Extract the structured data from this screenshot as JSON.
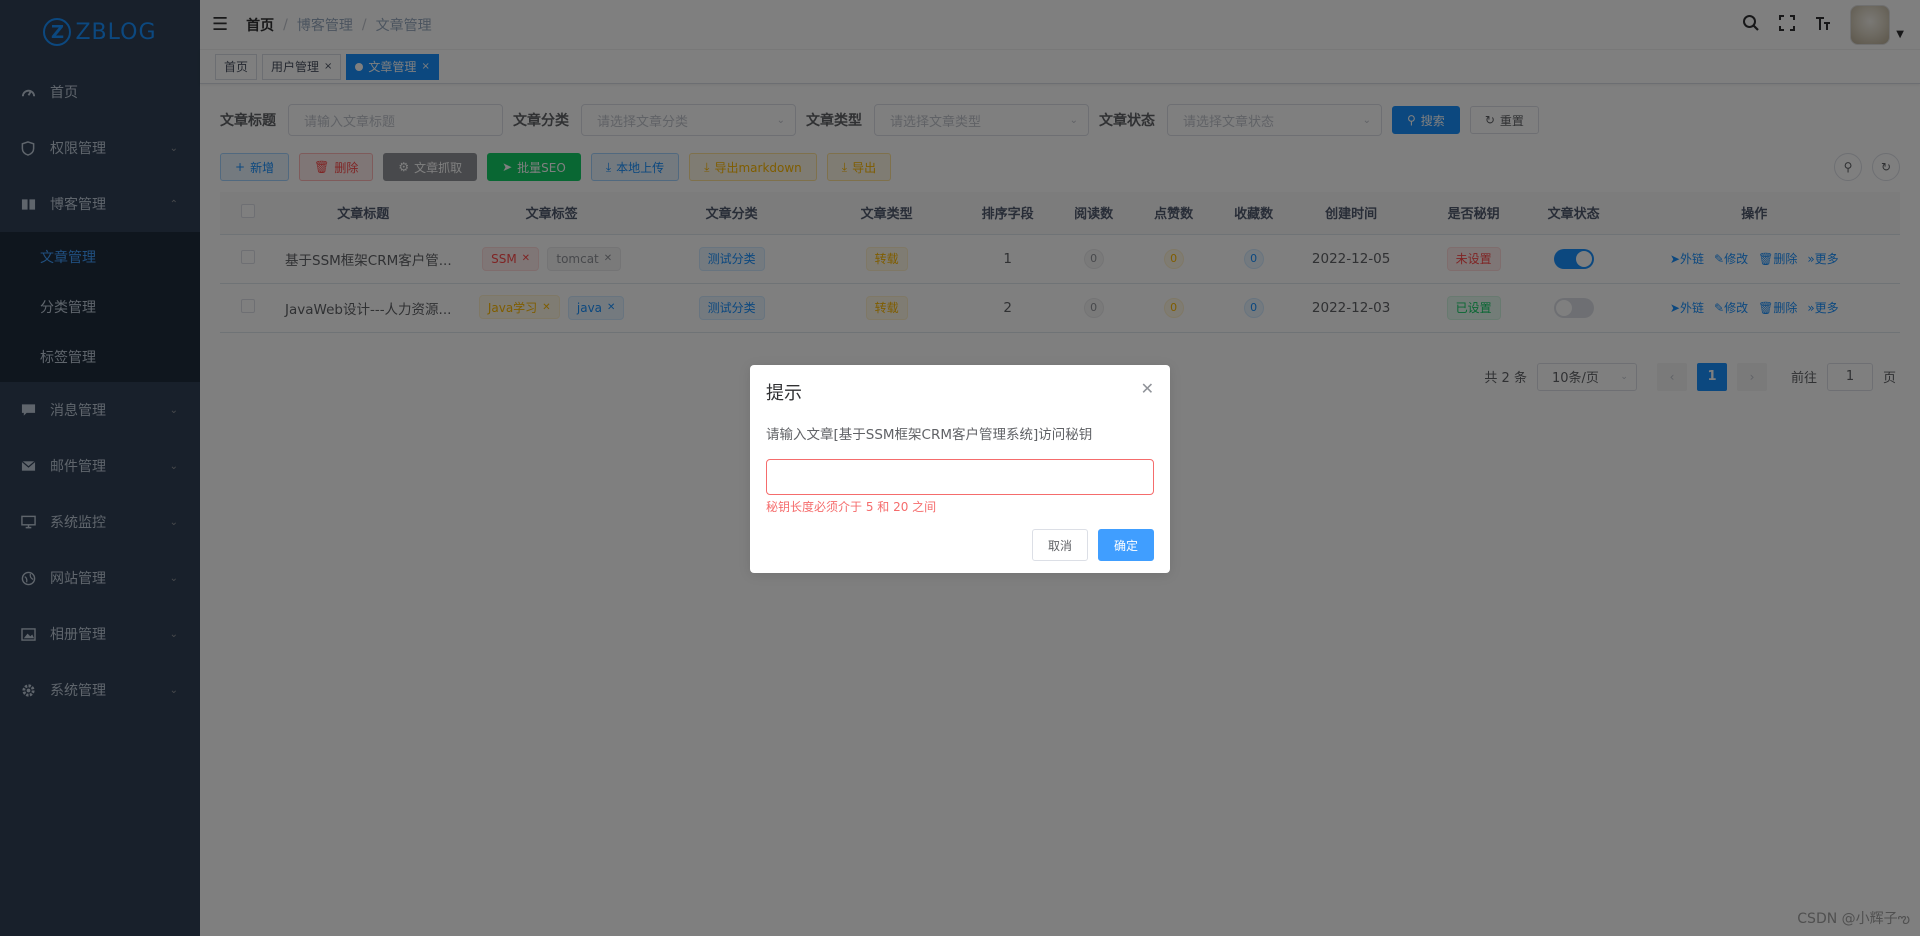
{
  "app": {
    "logo_letter": "Z",
    "logo_text": "ZBLOG"
  },
  "sidebar": {
    "items": [
      {
        "label": "首页",
        "icon": "dashboard-icon"
      },
      {
        "label": "权限管理",
        "icon": "shield-icon"
      },
      {
        "label": "博客管理",
        "icon": "book-icon"
      },
      {
        "label": "消息管理",
        "icon": "message-icon"
      },
      {
        "label": "邮件管理",
        "icon": "mail-icon"
      },
      {
        "label": "系统监控",
        "icon": "monitor-icon"
      },
      {
        "label": "网站管理",
        "icon": "globe-icon"
      },
      {
        "label": "相册管理",
        "icon": "image-icon"
      },
      {
        "label": "系统管理",
        "icon": "gear-icon"
      }
    ],
    "sub_items": [
      {
        "label": "文章管理"
      },
      {
        "label": "分类管理"
      },
      {
        "label": "标签管理"
      }
    ]
  },
  "breadcrumb": {
    "items": [
      "首页",
      "博客管理",
      "文章管理"
    ]
  },
  "tags_view": {
    "tabs": [
      "首页",
      "用户管理",
      "文章管理"
    ]
  },
  "search": {
    "title_label": "文章标题",
    "title_placeholder": "请输入文章标题",
    "category_label": "文章分类",
    "category_placeholder": "请选择文章分类",
    "type_label": "文章类型",
    "type_placeholder": "请选择文章类型",
    "status_label": "文章状态",
    "status_placeholder": "请选择文章状态",
    "search_btn": "搜索",
    "reset_btn": "重置"
  },
  "toolbar": {
    "add": "新增",
    "delete": "删除",
    "crawl": "文章抓取",
    "seo": "批量SEO",
    "upload": "本地上传",
    "export_md": "导出markdown",
    "export": "导出"
  },
  "table": {
    "headers": [
      "文章标题",
      "文章标签",
      "文章分类",
      "文章类型",
      "排序字段",
      "阅读数",
      "点赞数",
      "收藏数",
      "创建时间",
      "是否秘钥",
      "文章状态",
      "操作"
    ],
    "rows": [
      {
        "title": "基于SSM框架CRM客户管...",
        "tags": [
          "SSM",
          "tomcat"
        ],
        "category": "测试分类",
        "type": "转载",
        "sort": "1",
        "views": "0",
        "likes": "0",
        "favorites": "0",
        "created": "2022-12-05",
        "secret": "未设置",
        "status_on": true
      },
      {
        "title": "JavaWeb设计---人力资源...",
        "tags": [
          "Java学习",
          "java"
        ],
        "category": "测试分类",
        "type": "转载",
        "sort": "2",
        "views": "0",
        "likes": "0",
        "favorites": "0",
        "created": "2022-12-03",
        "secret": "已设置",
        "status_on": false
      }
    ],
    "ops": {
      "link": "外链",
      "edit": "修改",
      "delete": "删除",
      "more": "更多"
    }
  },
  "pagination": {
    "total": "共 2 条",
    "page_size": "10条/页",
    "current": "1",
    "goto": "前往",
    "goto_value": "1",
    "page_unit": "页"
  },
  "dialog": {
    "title": "提示",
    "message": "请输入文章[基于SSM框架CRM客户管理系统]访问秘钥",
    "error": "秘钥长度必须介于 5 和 20 之间",
    "cancel": "取消",
    "confirm": "确定"
  },
  "watermark": "CSDN @小辉子ఌ",
  "colors": {
    "sidebar_bg": "#304156",
    "primary": "#1890ff",
    "danger": "#ff4949",
    "error": "#f56c6c"
  }
}
